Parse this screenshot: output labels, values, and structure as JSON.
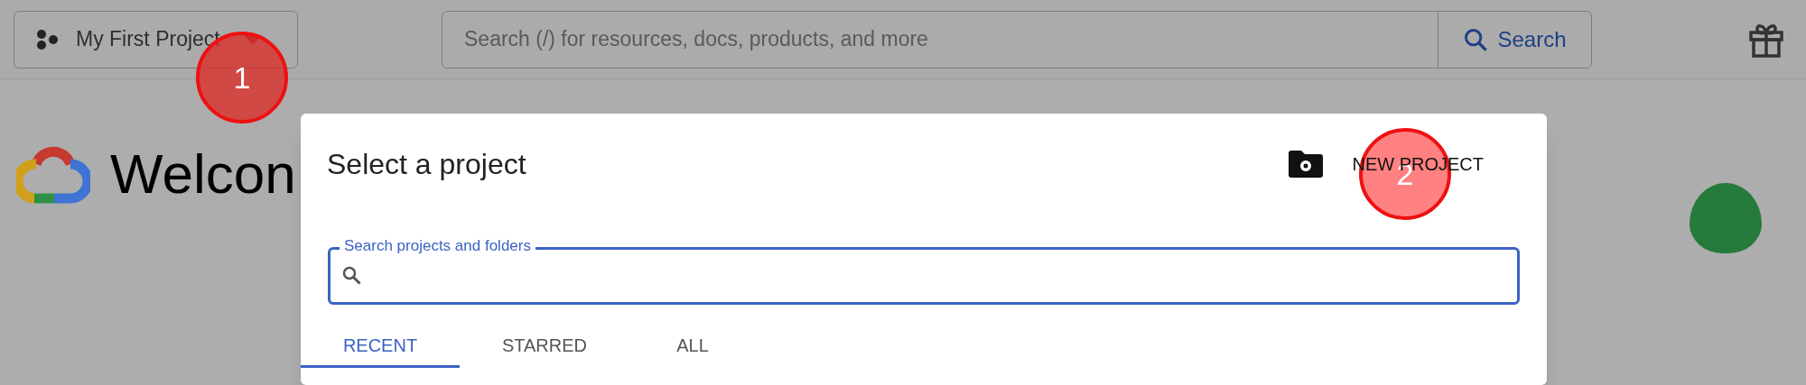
{
  "header": {
    "project": "My First Project",
    "search": {
      "placeholder": "Search (/) for resources, docs, products, and more"
    },
    "search_button": "Search"
  },
  "page": {
    "heading": "Welcon"
  },
  "dialog": {
    "title": "Select a project",
    "new_project": "NEW PROJECT",
    "search": {
      "label": "Search projects and folders"
    },
    "tabs": [
      {
        "label": "RECENT",
        "selected": true
      },
      {
        "label": "STARRED",
        "selected": false
      },
      {
        "label": "ALL",
        "selected": false
      }
    ]
  },
  "callouts": [
    {
      "label": "1",
      "kind": "dark"
    },
    {
      "label": "2",
      "kind": "light"
    }
  ]
}
